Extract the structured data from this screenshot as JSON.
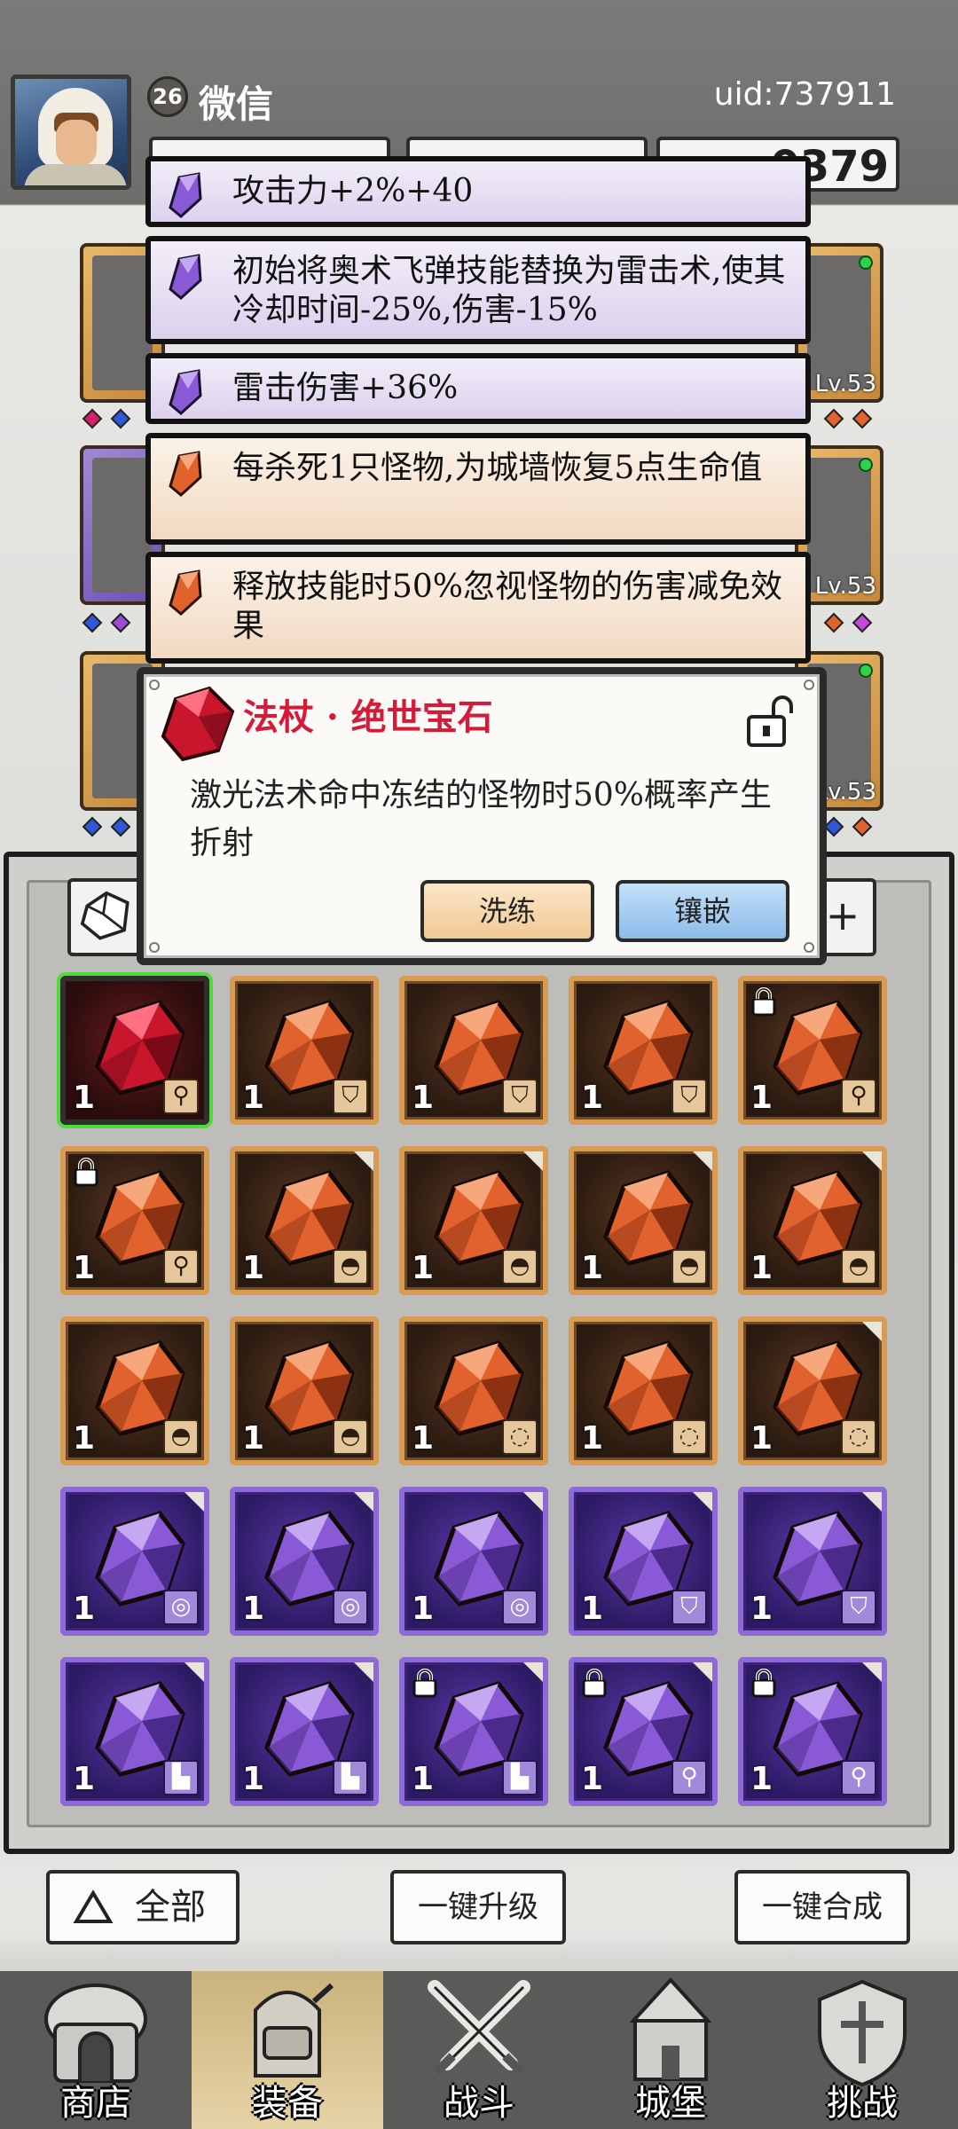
{
  "player": {
    "level": "26",
    "name": "微信",
    "uid": "uid:737911",
    "currency_value": "0379"
  },
  "equip_slots": {
    "lv_right_1": "Lv.53",
    "lv_right_2": "Lv.53",
    "lv_right_3": "Lv.53"
  },
  "tooltips": [
    {
      "type": "purple",
      "text": "攻击力+2%+40"
    },
    {
      "type": "purple",
      "text": "初始将奥术飞弹技能替换为雷击术,使其冷却时间-25%,伤害-15%"
    },
    {
      "type": "purple",
      "text": "雷击伤害+36%"
    },
    {
      "type": "orange",
      "text": "每杀死1只怪物,为城墙恢复5点生命值"
    },
    {
      "type": "orange",
      "text": "释放技能时50%忽视怪物的伤害减免效果"
    }
  ],
  "popup": {
    "title": "法杖 · 绝世宝石",
    "description": "激光法术命中冻结的怪物时50%概率产生折射",
    "wash_label": "洗练",
    "inlay_label": "镶嵌"
  },
  "inventory": {
    "filter_right": "+",
    "gems": [
      {
        "color": "red",
        "qty": "1",
        "slot": "staff",
        "locked": false,
        "new": false,
        "selected": true
      },
      {
        "color": "orange",
        "qty": "1",
        "slot": "armor",
        "locked": false,
        "new": false
      },
      {
        "color": "orange",
        "qty": "1",
        "slot": "armor",
        "locked": false,
        "new": false
      },
      {
        "color": "orange",
        "qty": "1",
        "slot": "armor",
        "locked": false,
        "new": false
      },
      {
        "color": "orange",
        "qty": "1",
        "slot": "staff",
        "locked": true,
        "new": false
      },
      {
        "color": "orange",
        "qty": "1",
        "slot": "staff",
        "locked": true,
        "new": false
      },
      {
        "color": "orange",
        "qty": "1",
        "slot": "hat",
        "locked": false,
        "new": true
      },
      {
        "color": "orange",
        "qty": "1",
        "slot": "hat",
        "locked": false,
        "new": true
      },
      {
        "color": "orange",
        "qty": "1",
        "slot": "hat",
        "locked": false,
        "new": true
      },
      {
        "color": "orange",
        "qty": "1",
        "slot": "hat",
        "locked": false,
        "new": true
      },
      {
        "color": "orange",
        "qty": "1",
        "slot": "hat",
        "locked": false,
        "new": false
      },
      {
        "color": "orange",
        "qty": "1",
        "slot": "hat",
        "locked": false,
        "new": false
      },
      {
        "color": "orange",
        "qty": "1",
        "slot": "necklace",
        "locked": false,
        "new": false
      },
      {
        "color": "orange",
        "qty": "1",
        "slot": "necklace",
        "locked": false,
        "new": false
      },
      {
        "color": "orange",
        "qty": "1",
        "slot": "necklace",
        "locked": false,
        "new": true
      },
      {
        "color": "purple",
        "qty": "1",
        "slot": "ring",
        "locked": false,
        "new": true
      },
      {
        "color": "purple",
        "qty": "1",
        "slot": "ring",
        "locked": false,
        "new": true
      },
      {
        "color": "purple",
        "qty": "1",
        "slot": "ring",
        "locked": false,
        "new": true
      },
      {
        "color": "purple",
        "qty": "1",
        "slot": "armor",
        "locked": false,
        "new": true
      },
      {
        "color": "purple",
        "qty": "1",
        "slot": "armor",
        "locked": false,
        "new": true
      },
      {
        "color": "purple",
        "qty": "1",
        "slot": "boots",
        "locked": false,
        "new": true
      },
      {
        "color": "purple",
        "qty": "1",
        "slot": "boots",
        "locked": false,
        "new": true
      },
      {
        "color": "purple",
        "qty": "1",
        "slot": "boots",
        "locked": true,
        "new": true
      },
      {
        "color": "purple",
        "qty": "1",
        "slot": "staff",
        "locked": true,
        "new": true
      },
      {
        "color": "purple",
        "qty": "1",
        "slot": "staff",
        "locked": true,
        "new": true
      }
    ]
  },
  "actions": {
    "all_label": "全部",
    "upgrade_label": "一键升级",
    "merge_label": "一键合成"
  },
  "nav": [
    {
      "label": "商店",
      "icon": "shop-icon",
      "active": false
    },
    {
      "label": "装备",
      "icon": "backpack-icon",
      "active": true
    },
    {
      "label": "战斗",
      "icon": "crossed-swords-icon",
      "active": false
    },
    {
      "label": "城堡",
      "icon": "castle-icon",
      "active": false
    },
    {
      "label": "挑战",
      "icon": "shield-icon",
      "active": false
    }
  ],
  "colors": {
    "popup_title": "#d41c3a",
    "orange_gem": "#e2622e",
    "purple_gem": "#8a5ad6",
    "red_gem": "#c8162c",
    "selected_border": "#4fdc3a"
  }
}
